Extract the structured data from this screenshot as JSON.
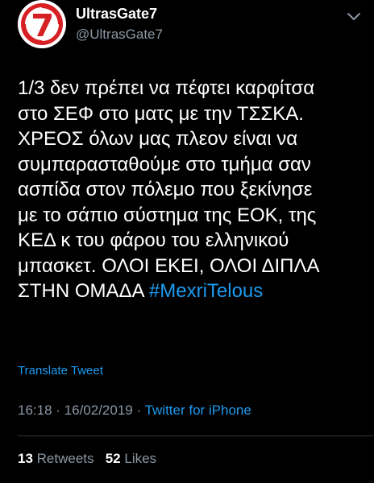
{
  "tweet": {
    "author": {
      "name": "UltrasGate7",
      "handle": "@UltrasGate7",
      "avatar_icon": "gate7-logo-icon"
    },
    "menu_icon": "chevron-down-icon",
    "text_lines": [
      "1/3 δεν πρέπει να πέφτει καρφίτσα",
      "στο ΣΕΦ στο ματς με την ΤΣΣΚΑ.",
      "ΧΡΕΟΣ όλων μας πλεον είναι να",
      "συμπαρασταθούμε στο τμήμα σαν",
      "ασπίδα στον πόλεμο που ξεκίνησε",
      "με το σάπιο σύστημα της ΕΟΚ, της",
      "ΚΕΔ κ του φάρου του ελληνικού",
      "μπασκετ. ΟΛΟΙ ΕΚΕΙ, ΟΛΟΙ ΔΙΠΛΑ"
    ],
    "last_line_text": "ΣΤΗΝ ΟΜΑΔΑ ",
    "hashtag": "#MexriTelous",
    "translate_label": "Translate Tweet",
    "time": "16:18",
    "date": "16/02/2019",
    "separator": " · ",
    "source": "Twitter for iPhone",
    "retweets_count": "13",
    "retweets_label": "Retweets",
    "likes_count": "52",
    "likes_label": "Likes"
  },
  "colors": {
    "background": "#000000",
    "text": "#ffffff",
    "secondary": "#8b98a5",
    "link": "#1d9bf0",
    "divider": "#2f3336",
    "logo_red": "#d62024"
  }
}
